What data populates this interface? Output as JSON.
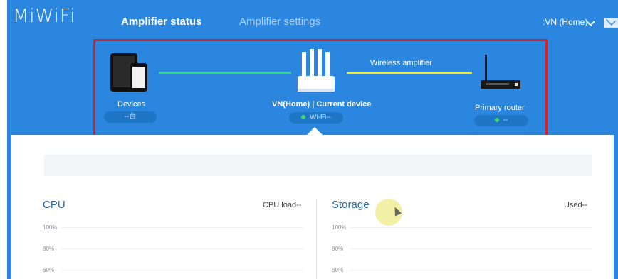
{
  "header": {
    "logo": "MiWiFi",
    "tabs": [
      {
        "label": "Amplifier status",
        "active": true
      },
      {
        "label": "Amplifier settings",
        "active": false
      }
    ],
    "user_label": ":VN (Home)"
  },
  "topology": {
    "devices": {
      "label": "Devices",
      "pill": "--台"
    },
    "current": {
      "label": "VN(Home) | Current device",
      "pill": "Wi-Fi--"
    },
    "primary": {
      "label": "Primary router",
      "pill": "--"
    },
    "link_label": "Wireless amplifier",
    "colors": {
      "link_left": "#34d38a",
      "link_right": "#f3e82b",
      "highlight_box": "#d61f26"
    }
  },
  "cpu": {
    "title": "CPU",
    "load_label": "CPU load--",
    "ticks": [
      "100%",
      "80%",
      "60%"
    ]
  },
  "storage": {
    "title": "Storage",
    "used_label": "Used--",
    "ticks": [
      "100%",
      "80%",
      "60%"
    ]
  },
  "colors": {
    "primary": "#2b86df",
    "panel": "#ffffff"
  }
}
